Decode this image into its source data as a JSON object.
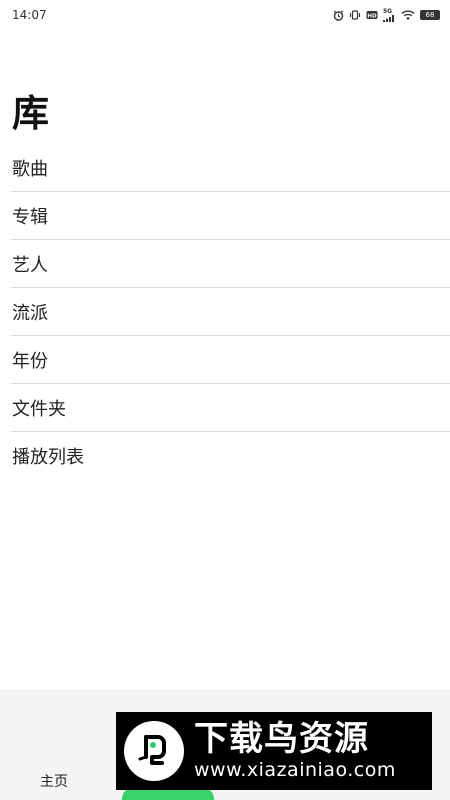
{
  "status_bar": {
    "time": "14:07",
    "network_label": "5G",
    "battery": "68",
    "icons": [
      "alarm-icon",
      "vibrate-icon",
      "hd-icon",
      "signal-icon",
      "wifi-icon",
      "battery-icon"
    ]
  },
  "page": {
    "title": "库"
  },
  "library": {
    "items": [
      {
        "label": "歌曲"
      },
      {
        "label": "专辑"
      },
      {
        "label": "艺人"
      },
      {
        "label": "流派"
      },
      {
        "label": "年份"
      },
      {
        "label": "文件夹"
      },
      {
        "label": "播放列表"
      }
    ]
  },
  "bottom_nav": {
    "home_label": "主页",
    "active_color": "#39d36b"
  },
  "watermark": {
    "title": "下载鸟资源",
    "url": "www.xiazainiao.com"
  }
}
